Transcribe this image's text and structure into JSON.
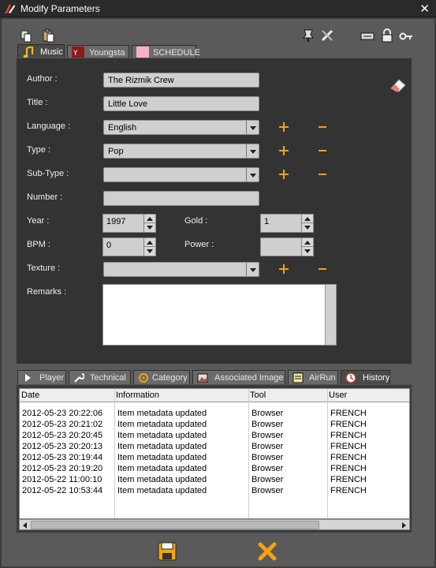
{
  "window": {
    "title": "Modify Parameters",
    "close_glyph": "✕"
  },
  "toolbar": {
    "left_icons": [
      "copy-icon",
      "paste-icon"
    ],
    "right_icons": [
      "pin-icon",
      "tools-icon",
      "keyboard-icon",
      "lock-icon",
      "key-icon"
    ]
  },
  "tabs": [
    {
      "label": "Music",
      "icon": "music-note-icon",
      "active": true
    },
    {
      "label": "Youngsta",
      "icon": "youngsta-logo-icon",
      "active": false
    },
    {
      "label": "SCHEDULE",
      "icon": "pink-square-icon",
      "active": false
    }
  ],
  "form": {
    "author_label": "Author :",
    "author_value": "The Rizmik Crew",
    "title_label": "Title :",
    "title_value": "Little Love",
    "language_label": "Language :",
    "language_value": "English",
    "type_label": "Type :",
    "type_value": "Pop",
    "subtype_label": "Sub-Type :",
    "subtype_value": "",
    "number_label": "Number :",
    "number_value": "",
    "year_label": "Year :",
    "year_value": "1997",
    "gold_label": "Gold :",
    "gold_value": "1",
    "bpm_label": "BPM :",
    "bpm_value": "0",
    "power_label": "Power :",
    "power_value": "",
    "texture_label": "Texture :",
    "texture_value": "",
    "remarks_label": "Remarks :",
    "remarks_value": ""
  },
  "bottom_tabs": [
    {
      "label": "Player",
      "icon": "play-icon",
      "active": false
    },
    {
      "label": "Technical",
      "icon": "wrench-icon",
      "active": false
    },
    {
      "label": "Category",
      "icon": "category-icon",
      "active": false
    },
    {
      "label": "Associated Image",
      "icon": "image-icon",
      "active": false
    },
    {
      "label": "AirRun",
      "icon": "airrun-icon",
      "active": false
    },
    {
      "label": "History",
      "icon": "clock-icon",
      "active": true
    }
  ],
  "history": {
    "columns": [
      "Date",
      "Information",
      "Tool",
      "User"
    ],
    "rows": [
      [
        "2012-05-23 20:22:06",
        "Item metadata updated",
        "Browser",
        "FRENCH"
      ],
      [
        "2012-05-23 20:21:02",
        "Item metadata updated",
        "Browser",
        "FRENCH"
      ],
      [
        "2012-05-23 20:20:45",
        "Item metadata updated",
        "Browser",
        "FRENCH"
      ],
      [
        "2012-05-23 20:20:13",
        "Item metadata updated",
        "Browser",
        "FRENCH"
      ],
      [
        "2012-05-23 20:19:44",
        "Item metadata updated",
        "Browser",
        "FRENCH"
      ],
      [
        "2012-05-23 20:19:20",
        "Item metadata updated",
        "Browser",
        "FRENCH"
      ],
      [
        "2012-05-22 11:00:10",
        "Item metadata updated",
        "Browser",
        "FRENCH"
      ],
      [
        "2012-05-22 10:53:44",
        "Item metadata updated",
        "Browser",
        "FRENCH"
      ]
    ]
  },
  "footer": {
    "save_icon": "save-icon",
    "cancel_icon": "cancel-x-icon"
  },
  "colors": {
    "accent": "#f4a30f",
    "panel": "#333333",
    "frame": "#5a5a5a"
  }
}
